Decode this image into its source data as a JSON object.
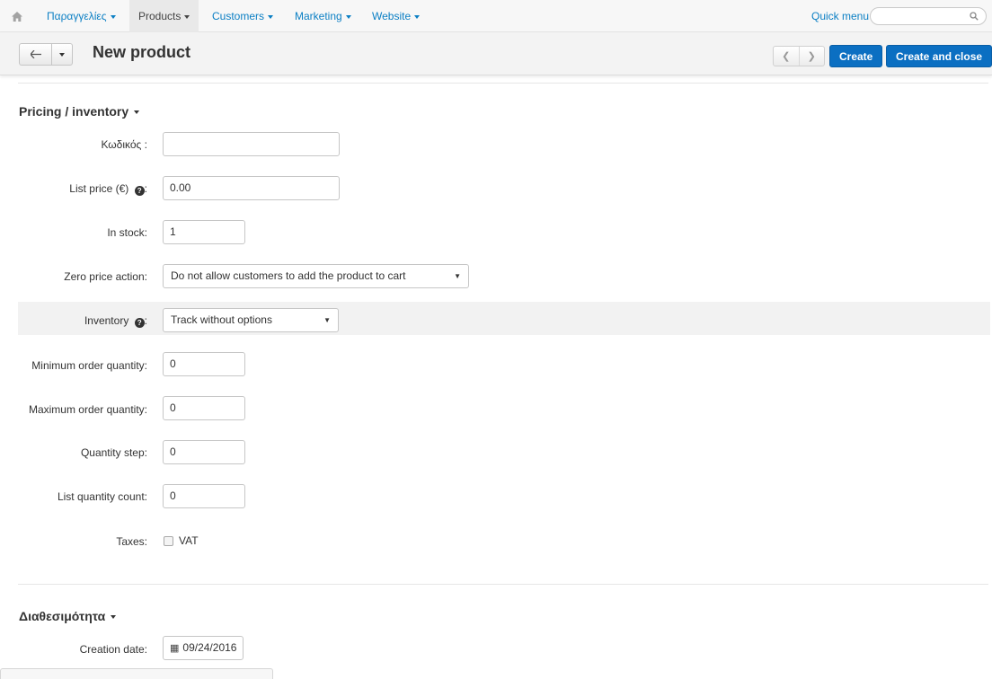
{
  "topnav": {
    "items": [
      {
        "label": "Παραγγελίες"
      },
      {
        "label": "Products"
      },
      {
        "label": "Customers"
      },
      {
        "label": "Marketing"
      },
      {
        "label": "Website"
      }
    ],
    "quick_menu": "Quick menu",
    "search_placeholder": ""
  },
  "header": {
    "title": "New product",
    "create": "Create",
    "create_close": "Create and close"
  },
  "pricing": {
    "title": "Pricing / inventory",
    "code_label": "Κωδικός :",
    "code_value": "",
    "list_price_label": "List price (€)",
    "list_price_value": "0.00",
    "in_stock_label": "In stock:",
    "in_stock_value": "1",
    "zero_price_label": "Zero price action:",
    "zero_price_value": "Do not allow customers to add the product to cart",
    "inventory_label": "Inventory",
    "inventory_value": "Track without options",
    "min_qty_label": "Minimum order quantity:",
    "min_qty_value": "0",
    "max_qty_label": "Maximum order quantity:",
    "max_qty_value": "0",
    "qty_step_label": "Quantity step:",
    "qty_step_value": "0",
    "list_qty_label": "List quantity count:",
    "list_qty_value": "0",
    "taxes_label": "Taxes:",
    "vat_label": "VAT",
    "vat_checked": false
  },
  "availability": {
    "title": "Διαθεσιμότητα",
    "creation_label": "Creation date:",
    "creation_value": "09/24/2016"
  },
  "colors": {
    "primary": "#0b6fc2",
    "link": "#0b7fc4"
  }
}
